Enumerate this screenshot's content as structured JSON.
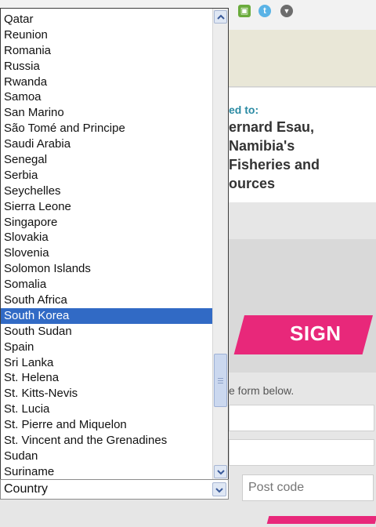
{
  "background": {
    "dedicated_text": "ed to:",
    "headline": "ernard Esau,\nNamibia's\nFisheries and\nources",
    "sign_button": "SIGN",
    "form_note": "e form below.",
    "post_code_placeholder": "Post code"
  },
  "dropdown": {
    "items": [
      "Qatar",
      "Reunion",
      "Romania",
      "Russia",
      "Rwanda",
      "Samoa",
      "San Marino",
      "São Tomé and Principe",
      "Saudi Arabia",
      "Senegal",
      "Serbia",
      "Seychelles",
      "Sierra Leone",
      "Singapore",
      "Slovakia",
      "Slovenia",
      "Solomon Islands",
      "Somalia",
      "South Africa",
      "South Korea",
      "South Sudan",
      "Spain",
      "Sri Lanka",
      "St. Helena",
      "St. Kitts-Nevis",
      "St. Lucia",
      "St. Pierre and Miquelon",
      "St. Vincent and the Grenadines",
      "Sudan",
      "Suriname"
    ],
    "selected": "South Korea"
  },
  "select": {
    "value": "Country"
  },
  "colors": {
    "selection": "#316ac5",
    "accent_pink": "#e8287a",
    "teal": "#2a8aa3"
  },
  "icons": [
    "bookmark-green-icon",
    "twitter-icon",
    "share-icon",
    "chevron-up-icon",
    "chevron-down-icon"
  ]
}
